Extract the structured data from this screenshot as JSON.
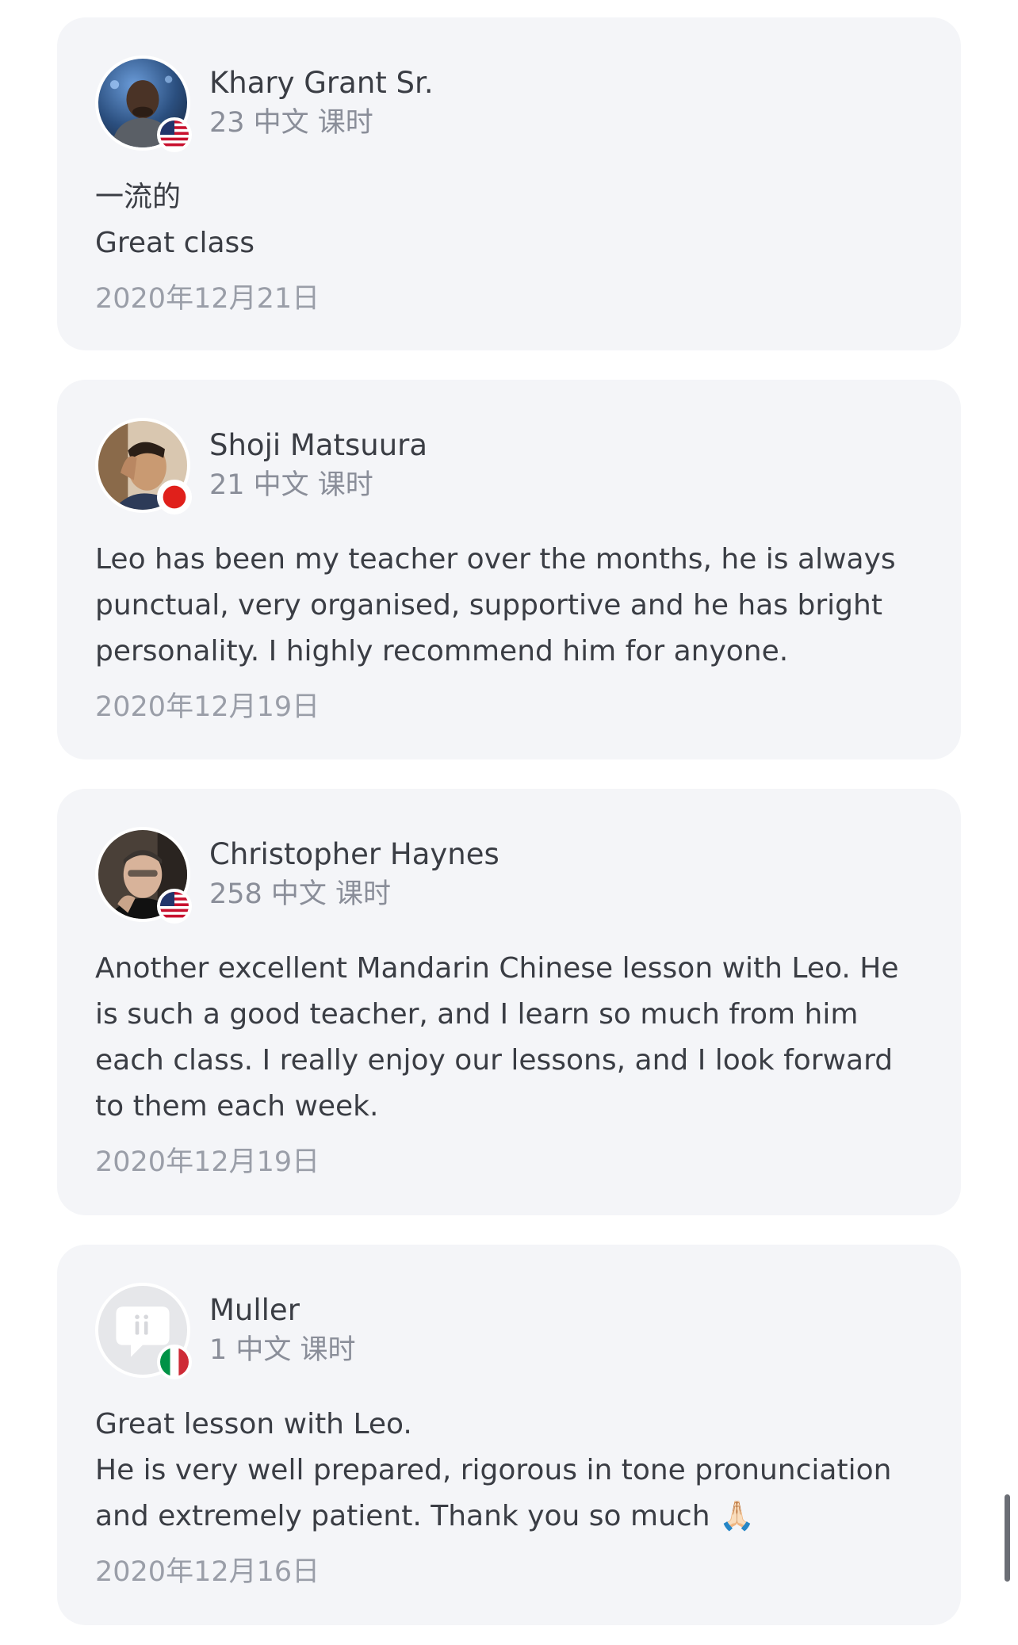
{
  "reviews": [
    {
      "name": "Khary Grant Sr.",
      "lessons": "23 中文 课时",
      "text": "一流的\nGreat class",
      "date": "2020年12月21日",
      "avatar_icon": "avatar-photo-icon",
      "flag_icon": "us-flag-icon"
    },
    {
      "name": "Shoji Matsuura",
      "lessons": "21 中文 课时",
      "text": "Leo has been my teacher over the months, he is always punctual, very organised, supportive and he has bright personality. I highly recommend him for anyone.",
      "date": "2020年12月19日",
      "avatar_icon": "avatar-photo-icon",
      "flag_icon": "japan-flag-icon"
    },
    {
      "name": "Christopher Haynes",
      "lessons": "258 中文 课时",
      "text": "Another excellent Mandarin Chinese lesson with Leo. He is such a good teacher, and I learn so much from him each class. I really enjoy our lessons, and I look forward to them each week.",
      "date": "2020年12月19日",
      "avatar_icon": "avatar-photo-icon",
      "flag_icon": "us-flag-icon"
    },
    {
      "name": "Muller",
      "lessons": "1 中文 课时",
      "text": "Great lesson with Leo.\nHe is very well prepared, rigorous in tone pronunciation and extremely patient. Thank you so much 🙏🏻",
      "date": "2020年12月16日",
      "avatar_icon": "default-avatar-icon",
      "flag_icon": "italy-flag-icon"
    }
  ],
  "colors": {
    "card_background": "#f4f5f8",
    "text_primary": "#3a3d44",
    "text_secondary": "#8a8e99"
  }
}
